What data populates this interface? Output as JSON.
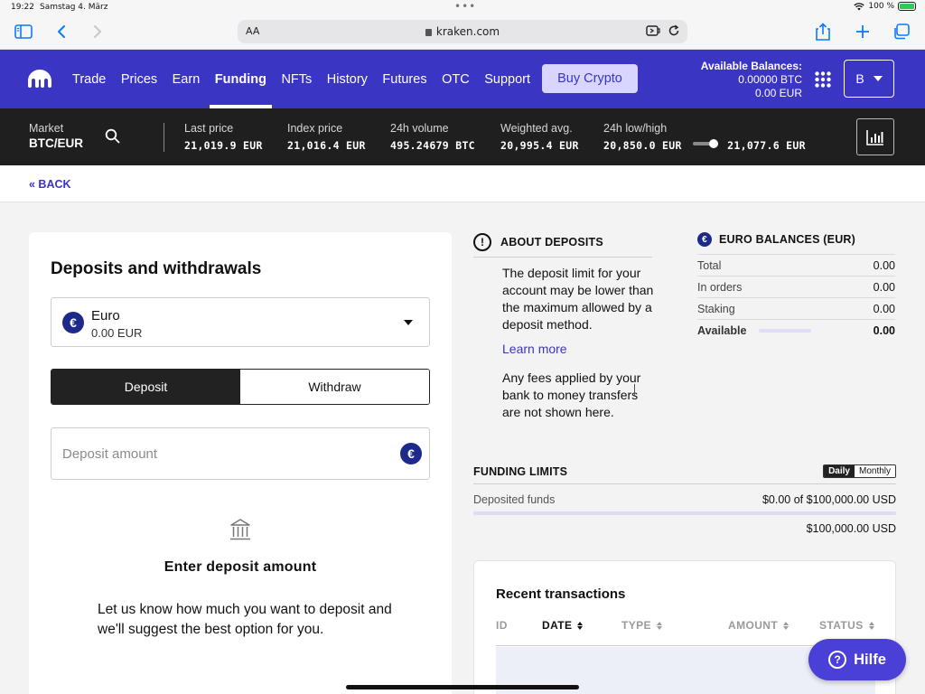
{
  "status_bar": {
    "time": "19:22",
    "date": "Samstag 4. März",
    "battery": "100 %"
  },
  "safari": {
    "aa": "AA",
    "url": "kraken.com"
  },
  "nav": {
    "items": [
      {
        "label": "Trade"
      },
      {
        "label": "Prices"
      },
      {
        "label": "Earn"
      },
      {
        "label": "Funding",
        "active": true
      },
      {
        "label": "NFTs"
      },
      {
        "label": "History"
      },
      {
        "label": "Futures"
      },
      {
        "label": "OTC"
      },
      {
        "label": "Support"
      }
    ],
    "buy_label": "Buy Crypto",
    "balances_title": "Available Balances:",
    "balance_btc": "0.00000 BTC",
    "balance_eur": "0.00 EUR",
    "account_initial": "B",
    "brand_color": "#3b35c3"
  },
  "ticker": {
    "market_label": "Market",
    "pair": "BTC/EUR",
    "stats": [
      {
        "label": "Last price",
        "value": "21,019.9 EUR"
      },
      {
        "label": "Index price",
        "value": "21,016.4 EUR"
      },
      {
        "label": "24h volume",
        "value": "495.24679 BTC"
      },
      {
        "label": "Weighted avg.",
        "value": "20,995.4 EUR"
      },
      {
        "label": "24h low/high",
        "low": "20,850.0 EUR",
        "high": "21,077.6 EUR"
      }
    ]
  },
  "back_label": "« BACK",
  "deposit": {
    "title": "Deposits and withdrawals",
    "currency_name": "Euro",
    "currency_balance": "0.00 EUR",
    "tab_deposit": "Deposit",
    "tab_withdraw": "Withdraw",
    "amount_placeholder": "Deposit amount",
    "enter_title": "Enter deposit amount",
    "enter_desc": "Let us know how much you want to deposit and we'll suggest the best option for you."
  },
  "about": {
    "title": "ABOUT DEPOSITS",
    "p1": "The deposit limit for your account may be lower than the maximum allowed by a deposit method.",
    "link": "Learn more",
    "p2": "Any fees applied by your bank to money transfers are not shown here."
  },
  "euro_balances": {
    "title": "EURO BALANCES (EUR)",
    "rows": [
      {
        "label": "Total",
        "value": "0.00"
      },
      {
        "label": "In orders",
        "value": "0.00"
      },
      {
        "label": "Staking",
        "value": "0.00"
      },
      {
        "label": "Available",
        "value": "0.00"
      }
    ]
  },
  "funding_limits": {
    "title": "FUNDING LIMITS",
    "tab_daily": "Daily",
    "tab_monthly": "Monthly",
    "deposited_label": "Deposited funds",
    "deposited_value": "$0.00 of $100,000.00 USD",
    "limit_value": "$100,000.00 USD"
  },
  "recent": {
    "title": "Recent transactions",
    "columns": [
      {
        "label": "ID"
      },
      {
        "label": "DATE"
      },
      {
        "label": "TYPE"
      },
      {
        "label": "AMOUNT"
      },
      {
        "label": "STATUS"
      }
    ]
  },
  "help_label": "Hilfe"
}
